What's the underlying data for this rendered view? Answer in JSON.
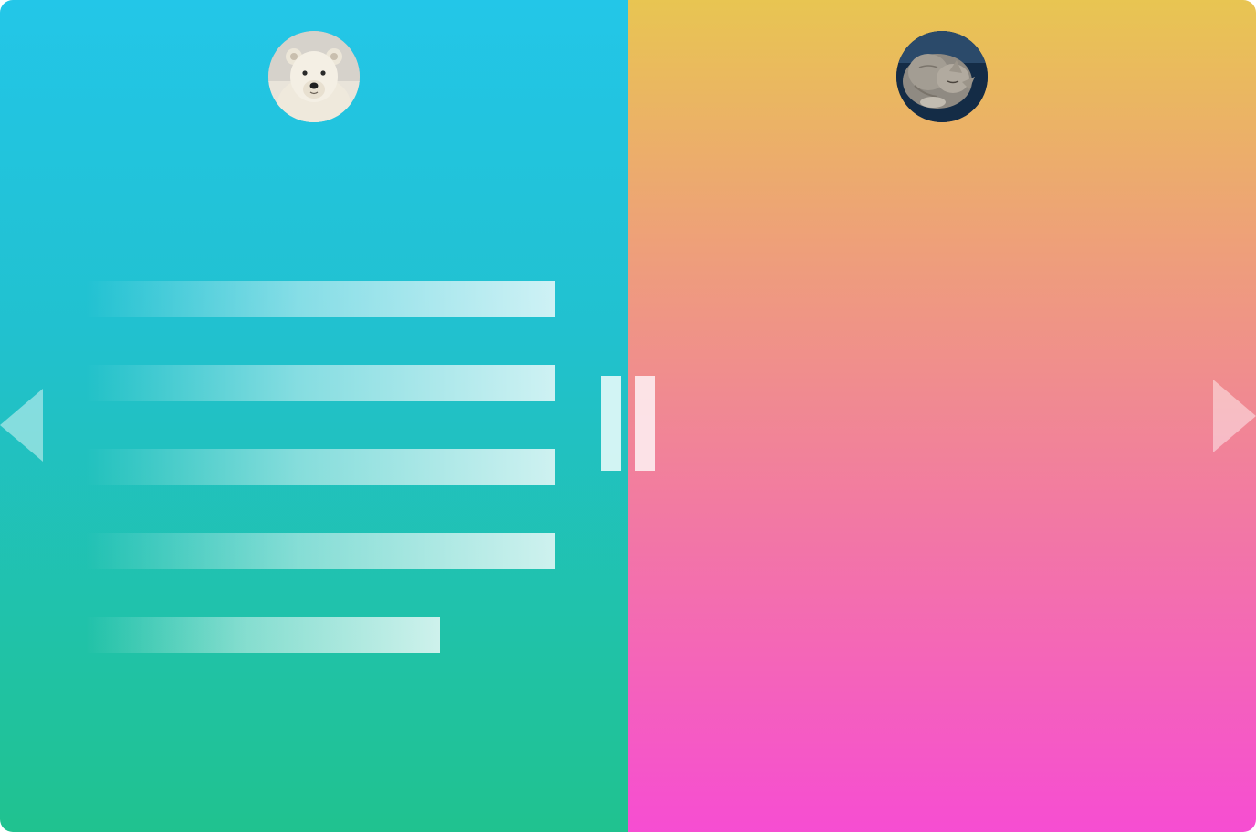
{
  "panels": {
    "left": {
      "avatar_icon": "polar-bear-photo",
      "gradient_colors": [
        "#23c6e8",
        "#21c1cf",
        "#20c28f"
      ],
      "text_placeholder_lines": 5
    },
    "right": {
      "avatar_icon": "sleeping-cat-photo",
      "gradient_colors": [
        "#e8c552",
        "#ee9f7a",
        "#f279a3",
        "#f64dd2"
      ]
    }
  },
  "divider": {
    "handle_icons": [
      "pause-bar-left",
      "pause-bar-right"
    ]
  },
  "navigation": {
    "prev_icon": "triangle-left-arrow",
    "next_icon": "triangle-right-arrow"
  }
}
